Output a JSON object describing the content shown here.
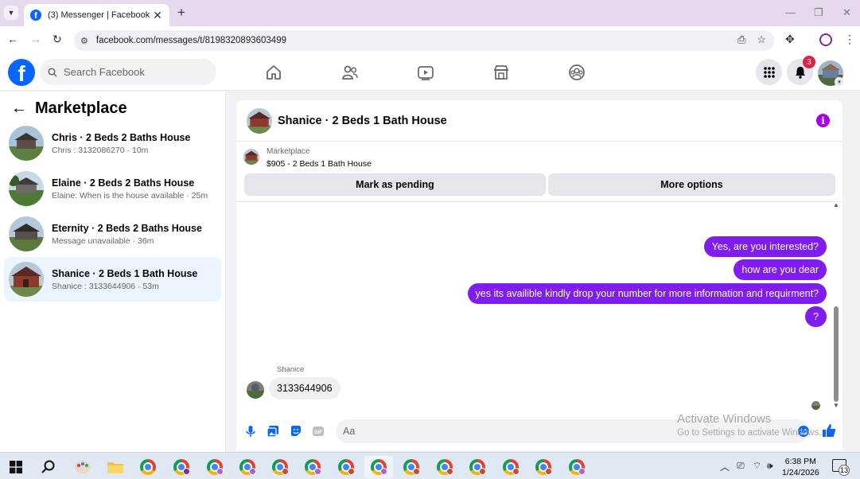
{
  "browser": {
    "tab_title": "(3) Messenger | Facebook",
    "url": "facebook.com/messages/t/8198320893603499",
    "new_tab_symbol": "+",
    "tab_close_symbol": "✕"
  },
  "header": {
    "search_placeholder": "Search Facebook",
    "notification_count": "3",
    "nav_icons": [
      "home-icon",
      "friends-icon",
      "video-icon",
      "marketplace-icon",
      "groups-icon"
    ],
    "brand_color": "#0866ff"
  },
  "sidebar": {
    "title": "Marketplace",
    "conversations": [
      {
        "title": "Chris · 2 Beds 2 Baths House",
        "subtitle": "Chris : 3132086270 · 10m",
        "active": false
      },
      {
        "title": "Elaine · 2 Beds 2 Baths House",
        "subtitle": "Elaine: When is the house available · 25m",
        "active": false
      },
      {
        "title": "Eternity · 2 Beds 2 Baths House",
        "subtitle": "Message unavailable · 36m",
        "active": false
      },
      {
        "title": "Shanice · 2 Beds 1 Bath House",
        "subtitle": "Shanice : 3133644906 · 53m",
        "active": true
      }
    ]
  },
  "chat": {
    "title": "Shanice · 2 Beds 1 Bath House",
    "marketplace_label": "Marketplace",
    "listing": "$905 - 2 Beds 1 Bath House",
    "mark_pending_label": "Mark as pending",
    "more_options_label": "More options",
    "messages_out": [
      "Yes, are you interested?",
      "how are you dear",
      "yes its availible kindly drop your number for more information and requirment?",
      "?"
    ],
    "sender_name": "Shanice",
    "message_in": "3133644906",
    "composer_placeholder": "Aa",
    "accent_color": "#7f1cf0"
  },
  "watermark": {
    "line1": "Activate Windows",
    "line2": "Go to Settings to activate Windows."
  },
  "taskbar": {
    "time": "6:38 PM",
    "date": "1/24/2026",
    "notification_count": "13"
  }
}
